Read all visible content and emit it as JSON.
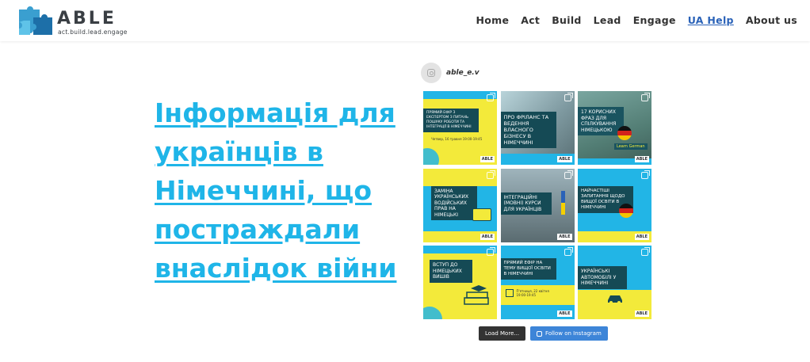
{
  "header": {
    "brand": "ABLE",
    "tagline": "act.build.lead.engage",
    "nav": [
      "Home",
      "Act",
      "Build",
      "Lead",
      "Engage",
      "UA Help",
      "About us"
    ],
    "active_nav": "UA Help"
  },
  "hero": {
    "title": "Інформація для українців в Німеччині, що постраждали внаслідок війни"
  },
  "instagram": {
    "username": "able_e.v",
    "tiles": [
      {
        "text": "Прямий ефір з експертом з питань пошуку роботи та інтеграції в Німеччині",
        "meta": "Четвер, 16 травня 19:00-19:45",
        "brand": "ABLE"
      },
      {
        "text": "Про фріланс та ведення власного бізнесу в Німеччині",
        "brand": "ABLE"
      },
      {
        "text": "17 корисних фраз для спілкування німецькою",
        "extra": "Learn German",
        "brand": "ABLE"
      },
      {
        "text": "Заміна українських водійських прав на німецькі",
        "brand": "ABLE"
      },
      {
        "text": "Інтеграційні (мовні) курси для українців",
        "brand": "ABLE"
      },
      {
        "text": "Найчастіші запитання щодо вищої освіти в Німеччині",
        "brand": "ABLE"
      },
      {
        "text": "Вступ до німецьких вишів",
        "brand": "ABLE"
      },
      {
        "text": "Прямий ефір на тему вищої освіти в Німеччині",
        "meta": "П'ятниця, 22 квітня 19:00-19:45",
        "brand": "ABLE"
      },
      {
        "text": "Українські автомобілі у Німеччині",
        "brand": "ABLE"
      }
    ],
    "load_more": "Load More...",
    "follow": "Follow on Instagram"
  },
  "colors": {
    "accent": "#1fb5e8",
    "yellow": "#f3ea3a",
    "dark_teal": "#154a55",
    "nav_active": "#2a62b8"
  }
}
